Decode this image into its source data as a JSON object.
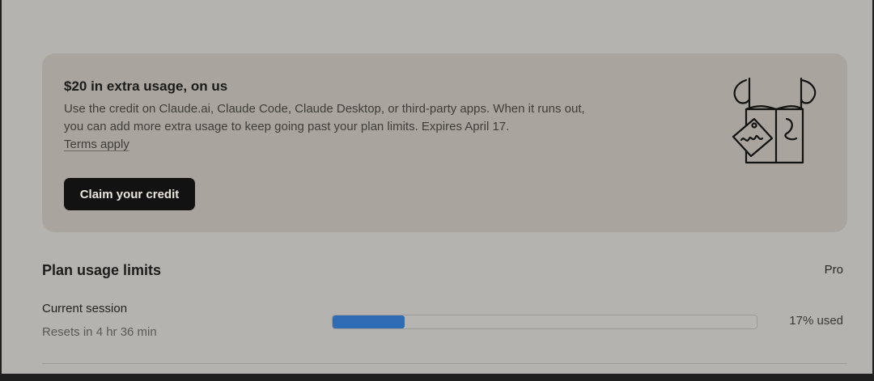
{
  "promo": {
    "title": "$20 in extra usage, on us",
    "body": "Use the credit on Claude.ai, Claude Code, Claude Desktop, or third-party apps. When it runs out, you can add more extra usage to keep going past your plan limits. Expires April 17.",
    "terms_link": "Terms apply",
    "claim_button": "Claim your credit",
    "illustration_icon": "gift-tag-illustration"
  },
  "usage": {
    "section_title": "Plan usage limits",
    "plan": "Pro",
    "current_session": {
      "label": "Current session",
      "reset": "Resets in 4 hr 36 min",
      "percent_used": 17,
      "usage_text": "17% used"
    }
  },
  "colors": {
    "bar_fill": "#2f6cb5",
    "button_bg": "#121212",
    "card_bg": "#a9a59e"
  }
}
